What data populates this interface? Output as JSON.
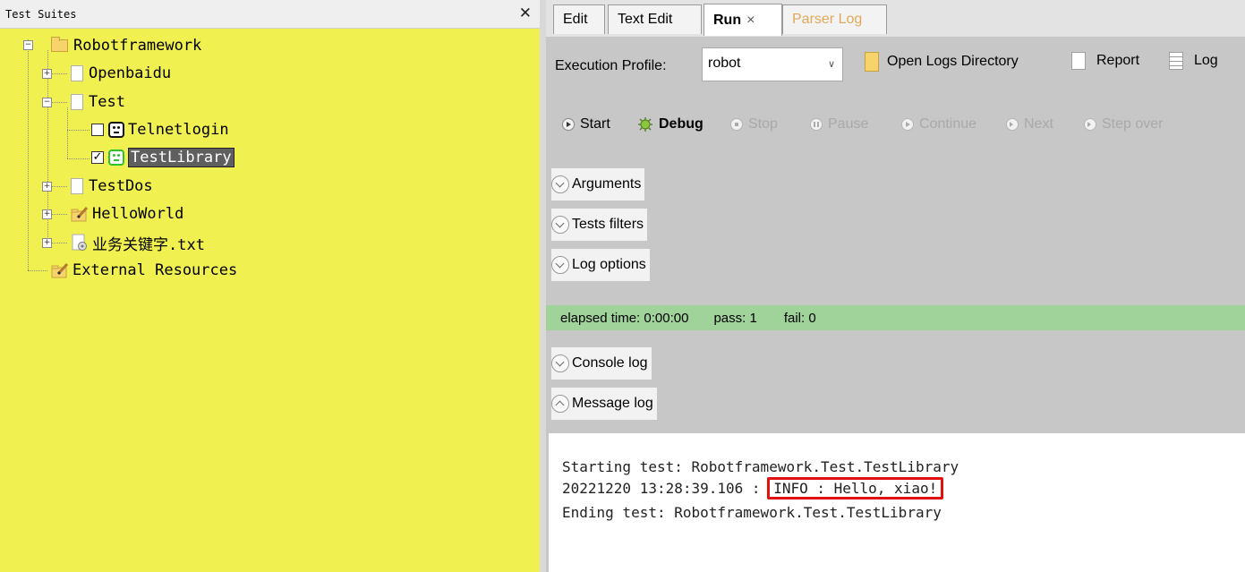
{
  "left_panel": {
    "title": "Test Suites",
    "tree": {
      "root": "Robotframework",
      "items": [
        {
          "label": "Openbaidu"
        },
        {
          "label": "Test",
          "children": [
            {
              "label": "Telnetlogin",
              "checked": false
            },
            {
              "label": "TestLibrary",
              "checked": true,
              "selected": true
            }
          ]
        },
        {
          "label": "TestDos"
        },
        {
          "label": "HelloWorld"
        },
        {
          "label": "业务关键字.txt"
        }
      ],
      "external": "External Resources"
    }
  },
  "tabs": [
    {
      "label": "Edit"
    },
    {
      "label": "Text Edit"
    },
    {
      "label": "Run",
      "active": true
    },
    {
      "label": "Parser Log",
      "disabled": true
    }
  ],
  "toolbar": {
    "execution_profile_label": "Execution Profile:",
    "execution_profile_value": "robot",
    "open_logs_label": "Open Logs Directory",
    "report_label": "Report",
    "log_label": "Log"
  },
  "run_buttons": {
    "start": "Start",
    "debug": "Debug",
    "stop": "Stop",
    "pause": "Pause",
    "continue": "Continue",
    "next": "Next",
    "step_over": "Step over"
  },
  "sections": {
    "arguments": "Arguments",
    "tests_filters": "Tests filters",
    "log_options": "Log options",
    "console_log": "Console log",
    "message_log": "Message log"
  },
  "status": {
    "elapsed": "elapsed time: 0:00:00",
    "pass": "pass: 1",
    "fail": "fail: 0"
  },
  "message_log": {
    "line1": "Starting test: Robotframework.Test.TestLibrary",
    "line2_prefix": "20221220 13:28:39.106 : ",
    "line2_highlight": "INFO : Hello, xiao!",
    "line3": "Ending test: Robotframework.Test.TestLibrary"
  },
  "colors": {
    "tree_background": "#f0f050",
    "status_bar": "#9fd39a",
    "highlight_border": "#e01010",
    "active_robot_icon": "#2cc22c"
  }
}
